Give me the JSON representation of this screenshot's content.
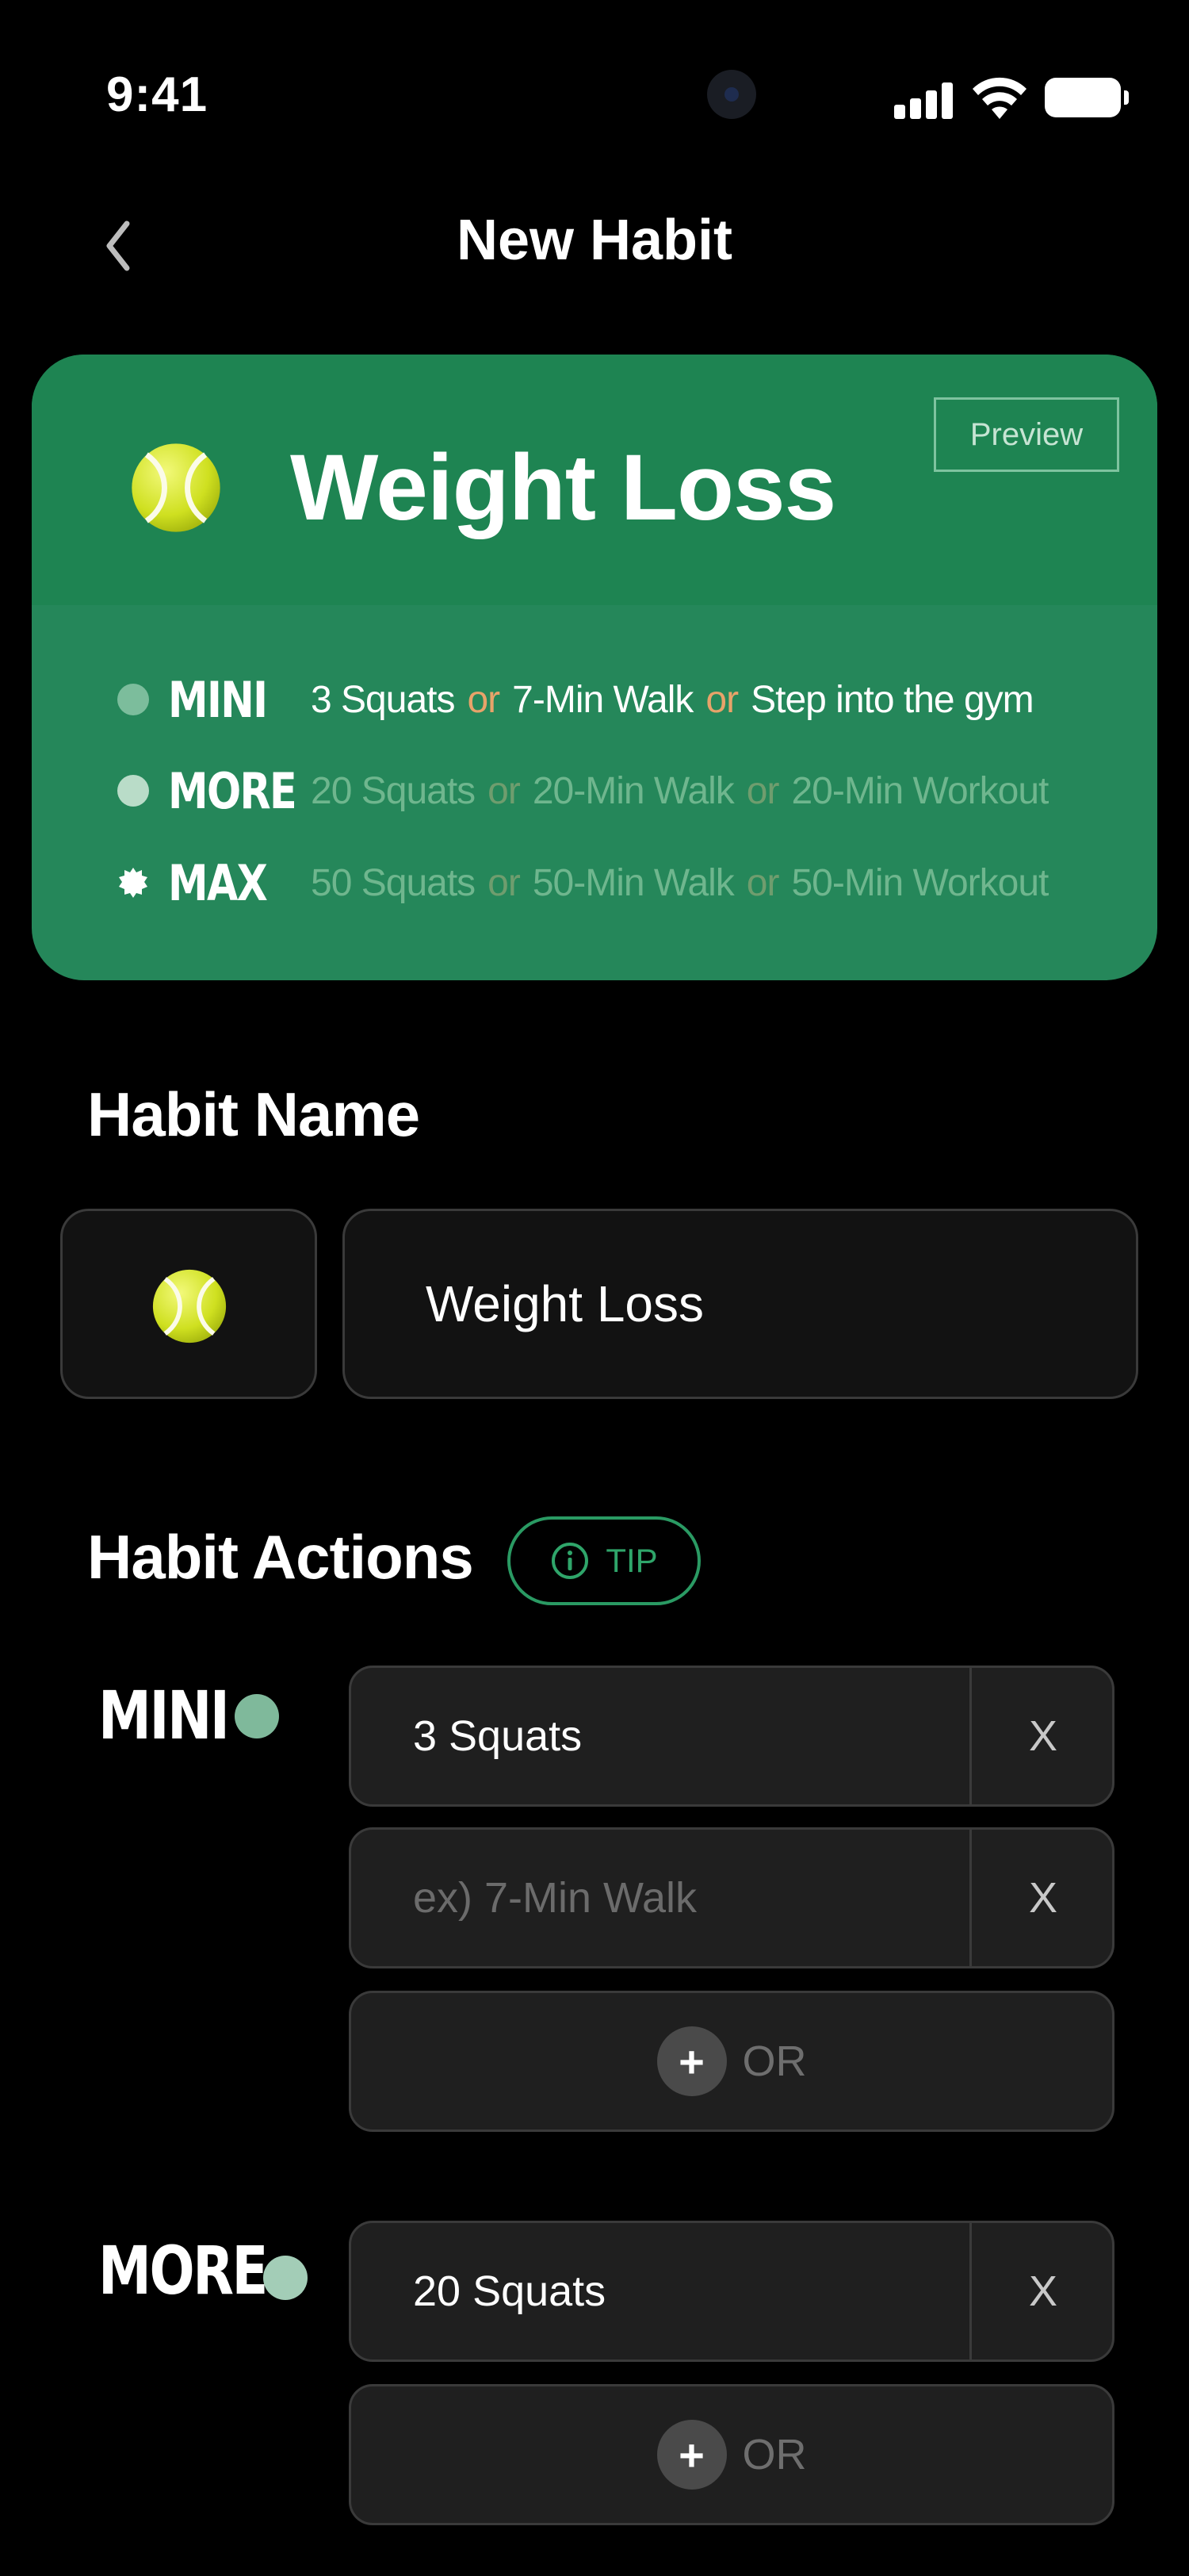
{
  "status_bar": {
    "time": "9:41"
  },
  "header": {
    "title": "New Habit"
  },
  "preview_card": {
    "title": "Weight Loss",
    "preview_label": "Preview",
    "levels": [
      {
        "name": "MINI",
        "actions": [
          "3 Squats",
          "7-Min Walk",
          "Step into the gym"
        ],
        "separator": "or"
      },
      {
        "name": "MORE",
        "actions": [
          "20 Squats",
          "20-Min Walk",
          "20-Min Workout"
        ],
        "separator": "or"
      },
      {
        "name": "MAX",
        "actions": [
          "50 Squats",
          "50-Min Walk",
          "50-Min Workout"
        ],
        "separator": "or"
      }
    ]
  },
  "habit_name": {
    "heading": "Habit Name",
    "value": "Weight Loss",
    "emoji_icon": "tennis-ball-icon"
  },
  "habit_actions": {
    "heading": "Habit Actions",
    "tip_label": "TIP",
    "groups": [
      {
        "label": "MINI",
        "dot_color": "#7fb99b",
        "fields": [
          {
            "value": "3 Squats",
            "placeholder": "",
            "remove_label": "X"
          },
          {
            "value": "",
            "placeholder": "ex) 7-Min Walk",
            "remove_label": "X"
          }
        ],
        "add_label": "OR"
      },
      {
        "label": "MORE",
        "dot_color": "#a3cdb7",
        "fields": [
          {
            "value": "20 Squats",
            "placeholder": "",
            "remove_label": "X"
          }
        ],
        "add_label": "OR"
      }
    ]
  },
  "colors": {
    "card_top": "#1e8452",
    "card_bottom": "#25875a",
    "accent_green": "#2fa56a",
    "or_highlight": "#e8a36a"
  }
}
